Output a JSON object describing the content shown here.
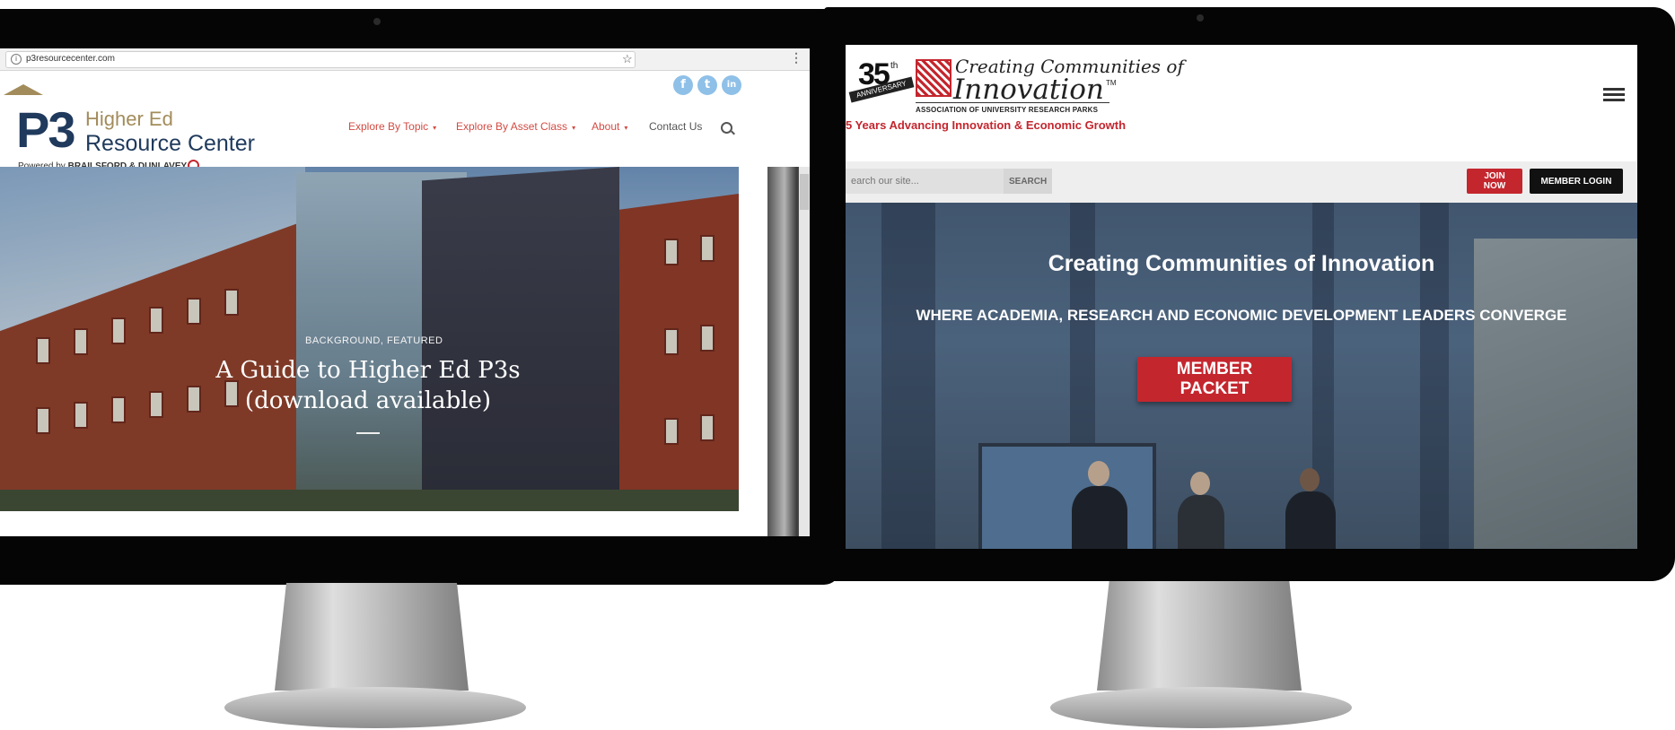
{
  "left_site": {
    "browser": {
      "url": "p3resourcecenter.com"
    },
    "logo": {
      "mark": "P3",
      "line1": "Higher Ed",
      "line2": "Resource Center",
      "powered_prefix": "Powered by",
      "powered_brand": "BRAILSFORD & DUNLAVEY"
    },
    "social": {
      "facebook": "f",
      "twitter": "t",
      "linkedin": "in"
    },
    "nav": {
      "topic": "Explore By Topic",
      "asset": "Explore By Asset Class",
      "about": "About",
      "contact": "Contact Us"
    },
    "hero": {
      "category": "BACKGROUND, FEATURED",
      "title": "A Guide to Higher Ed P3s (download available)"
    }
  },
  "right_site": {
    "logo": {
      "anniversary_number": "35",
      "anniversary_suffix": "th",
      "anniversary_ribbon": "ANNIVERSARY",
      "tagline_top": "Creating Communities of",
      "tagline_main": "Innovation",
      "trademark": "TM",
      "organization": "ASSOCIATION OF UNIVERSITY RESEARCH PARKS"
    },
    "subtitle": "5 Years Advancing Innovation & Economic Growth",
    "search": {
      "placeholder": "earch our site...",
      "button": "SEARCH"
    },
    "buttons": {
      "join": "JOIN NOW",
      "login": "MEMBER LOGIN"
    },
    "hero": {
      "title": "Creating Communities of Innovation",
      "subtitle": "WHERE ACADEMIA, RESEARCH AND ECONOMIC DEVELOPMENT LEADERS CONVERGE",
      "cta": "MEMBER PACKET"
    }
  },
  "icons": {
    "nav_caret": "▾",
    "star": "☆",
    "kebab": "⋮",
    "info": "i",
    "apple": ""
  },
  "colors": {
    "p3_navy": "#1f3a5c",
    "p3_gold": "#a38c5b",
    "nav_red": "#d24b43",
    "aurp_red": "#c4262e",
    "social_blue": "#8fc0e8"
  }
}
